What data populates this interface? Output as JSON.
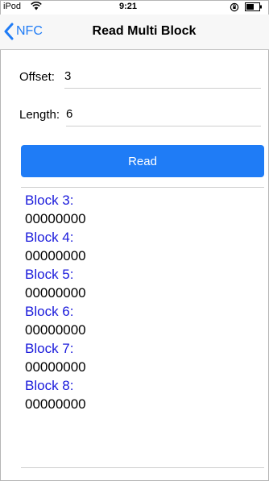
{
  "status_bar": {
    "carrier": "iPod",
    "time": "9:21"
  },
  "nav": {
    "back_label": "NFC",
    "title": "Read Multi Block"
  },
  "form": {
    "offset": {
      "label": "Offset:",
      "value": "3"
    },
    "length": {
      "label": "Length:",
      "value": "6"
    }
  },
  "read_button": "Read",
  "results": [
    {
      "label": "Block 3:",
      "value": "00000000"
    },
    {
      "label": "Block 4:",
      "value": "00000000"
    },
    {
      "label": "Block 5:",
      "value": "00000000"
    },
    {
      "label": "Block 6:",
      "value": "00000000"
    },
    {
      "label": "Block 7:",
      "value": "00000000"
    },
    {
      "label": "Block 8:",
      "value": "00000000"
    }
  ],
  "colors": {
    "accent": "#1f7cf6",
    "block_label": "#1a1adb"
  },
  "icons": [
    "wifi-icon",
    "back-chevron-icon",
    "orientation-lock-icon",
    "battery-icon"
  ]
}
